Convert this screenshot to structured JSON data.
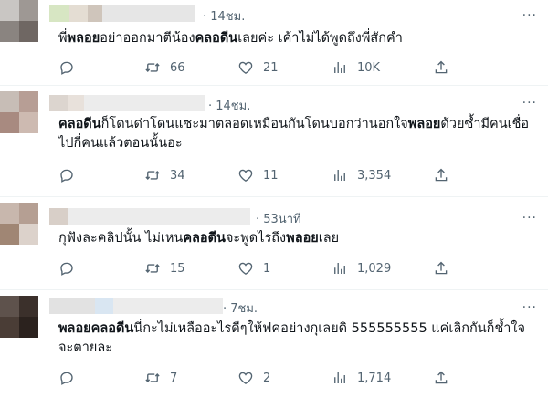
{
  "colors": {
    "text": "#0f1419",
    "muted": "#536471",
    "divider": "#eff3f4"
  },
  "more_label": "···",
  "tweets": [
    {
      "time": "14ชม.",
      "text": [
        {
          "t": "พี่",
          "b": false
        },
        {
          "t": "พลอย",
          "b": true
        },
        {
          "t": "อย่าออกมาตีน้อง",
          "b": false
        },
        {
          "t": "คลอดีน",
          "b": true
        },
        {
          "t": "เลยค่ะ เค้าไม่ได้พูดถึงพี่สักคำ",
          "b": false
        }
      ],
      "replies": "",
      "retweets": "66",
      "likes": "21",
      "views": "10K",
      "icons": [
        "reply-icon",
        "retweet-icon",
        "like-icon",
        "views-icon",
        "share-icon"
      ]
    },
    {
      "time": "14ชม.",
      "text": [
        {
          "t": "คลอดีน",
          "b": true
        },
        {
          "t": "ก็โดนด่าโดนแซะมาตลอดเหมือนกันโดนบอกว่านอกใจ",
          "b": false
        },
        {
          "t": "พลอย",
          "b": true
        },
        {
          "t": "ด้วยซ้ำมีคนเชื่อไปกี่คนแล้วตอนนั้นอะ",
          "b": false
        }
      ],
      "replies": "",
      "retweets": "34",
      "likes": "11",
      "views": "3,354",
      "icons": [
        "reply-icon",
        "retweet-icon",
        "like-icon",
        "views-icon",
        "share-icon"
      ]
    },
    {
      "time": "53นาที",
      "text": [
        {
          "t": "กุฟังละคลิปนั้น ไม่เหน",
          "b": false
        },
        {
          "t": "คลอดีน",
          "b": true
        },
        {
          "t": "จะพูดไรถึง",
          "b": false
        },
        {
          "t": "พลอย",
          "b": true
        },
        {
          "t": "เลย",
          "b": false
        }
      ],
      "replies": "",
      "retweets": "15",
      "likes": "1",
      "views": "1,029",
      "icons": [
        "reply-icon",
        "retweet-icon",
        "like-icon",
        "views-icon",
        "share-icon"
      ]
    },
    {
      "time": "7ชม.",
      "text": [
        {
          "t": "พลอย",
          "b": true
        },
        {
          "t": "คลอดีน",
          "b": true
        },
        {
          "t": "นี่กะไม่เหลืออะไรดีๆให้ฟคอย่างกุเลยดิ 555555555 แค่เลิกกันก็ช้ำใจจะตายละ",
          "b": false
        }
      ],
      "replies": "",
      "retweets": "7",
      "likes": "2",
      "views": "1,714",
      "icons": [
        "reply-icon",
        "retweet-icon",
        "like-icon",
        "views-icon",
        "share-icon"
      ]
    }
  ]
}
